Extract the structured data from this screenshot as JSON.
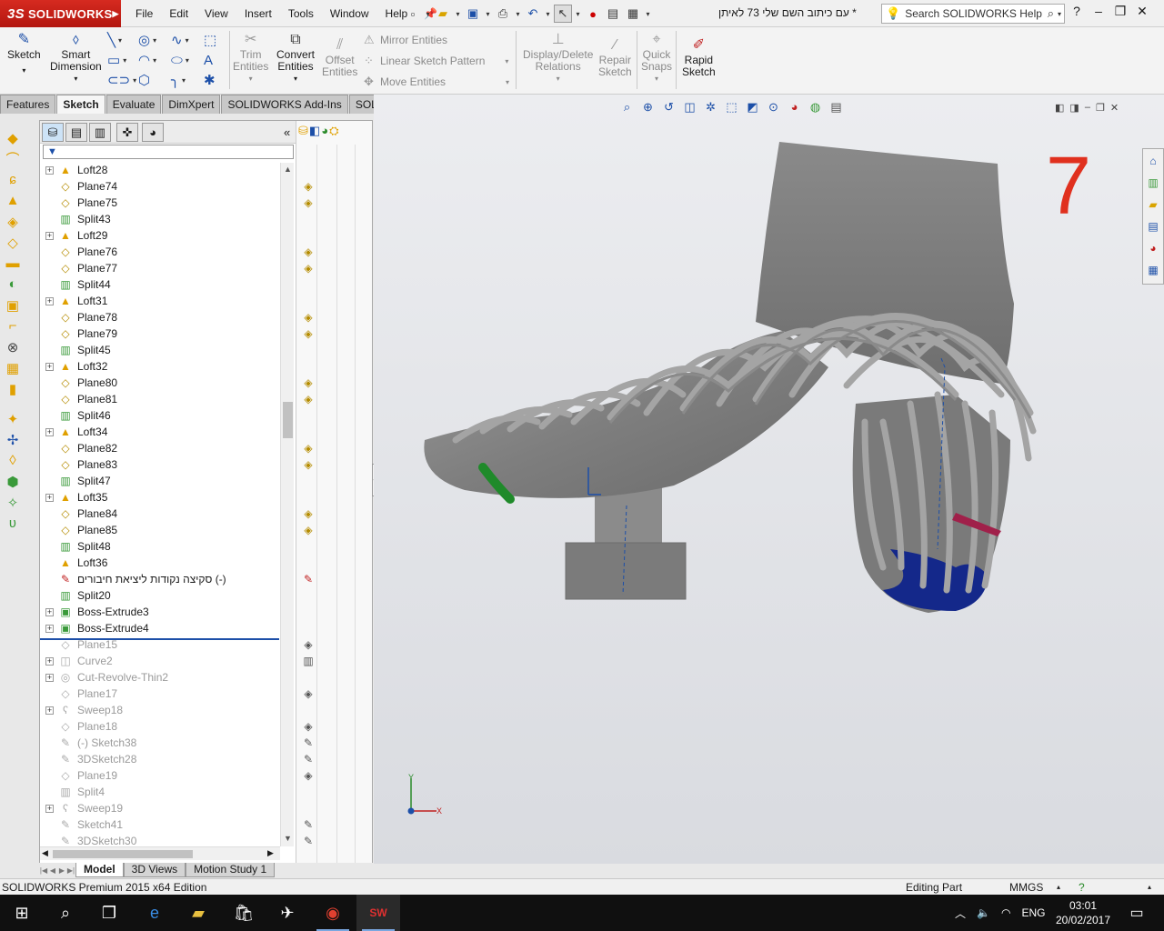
{
  "app": {
    "brand": "SOLIDWORKS",
    "ds_mark": "3S",
    "doc_title": "* עם כיתוב השם שלי 73 לאיתן",
    "menus": [
      "File",
      "Edit",
      "View",
      "Insert",
      "Tools",
      "Window",
      "Help"
    ],
    "search_placeholder": "Search SOLIDWORKS Help"
  },
  "toolbar": {
    "sketch": "Sketch",
    "smart_dimension_1": "Smart",
    "smart_dimension_2": "Dimension",
    "trim_1": "Trim",
    "trim_2": "Entities",
    "convert_1": "Convert",
    "convert_2": "Entities",
    "offset_1": "Offset",
    "offset_2": "Entities",
    "mirror": "Mirror Entities",
    "linear_pattern": "Linear Sketch Pattern",
    "move": "Move Entities",
    "display_1": "Display/Delete",
    "display_2": "Relations",
    "repair_1": "Repair",
    "repair_2": "Sketch",
    "quick_1": "Quick",
    "quick_2": "Snaps",
    "rapid_1": "Rapid",
    "rapid_2": "Sketch"
  },
  "cmd_tabs": [
    "Features",
    "Sketch",
    "Evaluate",
    "DimXpert",
    "SOLIDWORKS Add-Ins",
    "SOLIDWORKS MBD"
  ],
  "active_cmd_tab": "Sketch",
  "tree": [
    {
      "label": "Loft28",
      "type": "loft",
      "exp": true
    },
    {
      "label": "Plane74",
      "type": "plane",
      "exp": false
    },
    {
      "label": "Plane75",
      "type": "plane",
      "exp": false
    },
    {
      "label": "Split43",
      "type": "split",
      "exp": false
    },
    {
      "label": "Loft29",
      "type": "loft",
      "exp": true
    },
    {
      "label": "Plane76",
      "type": "plane",
      "exp": false
    },
    {
      "label": "Plane77",
      "type": "plane",
      "exp": false
    },
    {
      "label": "Split44",
      "type": "split",
      "exp": false
    },
    {
      "label": "Loft31",
      "type": "loft",
      "exp": true
    },
    {
      "label": "Plane78",
      "type": "plane",
      "exp": false
    },
    {
      "label": "Plane79",
      "type": "plane",
      "exp": false
    },
    {
      "label": "Split45",
      "type": "split",
      "exp": false
    },
    {
      "label": "Loft32",
      "type": "loft",
      "exp": true
    },
    {
      "label": "Plane80",
      "type": "plane",
      "exp": false
    },
    {
      "label": "Plane81",
      "type": "plane",
      "exp": false
    },
    {
      "label": "Split46",
      "type": "split",
      "exp": false
    },
    {
      "label": "Loft34",
      "type": "loft",
      "exp": true
    },
    {
      "label": "Plane82",
      "type": "plane",
      "exp": false
    },
    {
      "label": "Plane83",
      "type": "plane",
      "exp": false
    },
    {
      "label": "Split47",
      "type": "split",
      "exp": false
    },
    {
      "label": "Loft35",
      "type": "loft",
      "exp": true
    },
    {
      "label": "Plane84",
      "type": "plane",
      "exp": false
    },
    {
      "label": "Plane85",
      "type": "plane",
      "exp": false
    },
    {
      "label": "Split48",
      "type": "split",
      "exp": false
    },
    {
      "label": "Loft36",
      "type": "loft",
      "exp": false
    },
    {
      "label": "סקיצה נקודות ליציאת חיבורים (-)",
      "type": "sketch3d",
      "exp": false
    },
    {
      "label": "Split20",
      "type": "split",
      "exp": false
    },
    {
      "label": "Boss-Extrude3",
      "type": "boss",
      "exp": true
    },
    {
      "label": "Boss-Extrude4",
      "type": "boss",
      "exp": true
    },
    {
      "label": "Plane15",
      "type": "plane",
      "exp": false,
      "suppressed": true
    },
    {
      "label": "Curve2",
      "type": "curve",
      "exp": true,
      "suppressed": true
    },
    {
      "label": "Cut-Revolve-Thin2",
      "type": "revolve",
      "exp": true,
      "suppressed": true
    },
    {
      "label": "Plane17",
      "type": "plane",
      "exp": false,
      "suppressed": true
    },
    {
      "label": "Sweep18",
      "type": "sweep",
      "exp": true,
      "suppressed": true
    },
    {
      "label": "Plane18",
      "type": "plane",
      "exp": false,
      "suppressed": true
    },
    {
      "label": "(-) Sketch38",
      "type": "sketch",
      "exp": false,
      "suppressed": true
    },
    {
      "label": "3DSketch28",
      "type": "sketch3d",
      "exp": false,
      "suppressed": true
    },
    {
      "label": "Plane19",
      "type": "plane",
      "exp": false,
      "suppressed": true
    },
    {
      "label": "Split4",
      "type": "split",
      "exp": false,
      "suppressed": true
    },
    {
      "label": "Sweep19",
      "type": "sweep",
      "exp": true,
      "suppressed": true
    },
    {
      "label": "Sketch41",
      "type": "sketch",
      "exp": false,
      "suppressed": true
    },
    {
      "label": "3DSketch30",
      "type": "sketch3d",
      "exp": false,
      "suppressed": true
    }
  ],
  "bottom_tabs": [
    "Model",
    "3D Views",
    "Motion Study 1"
  ],
  "active_bottom_tab": "Model",
  "viewport_label": "7",
  "status": {
    "edition": "SOLIDWORKS Premium 2015 x64 Edition",
    "mode": "Editing Part",
    "units": "MMGS"
  },
  "taskbar": {
    "lang": "ENG",
    "time": "03:01",
    "date": "20/02/2017"
  },
  "colors": {
    "brand_red": "#d62a20",
    "accent_blue": "#1c4fa8",
    "feature_gold": "#e0a000",
    "viewport_number": "#e0301e"
  }
}
